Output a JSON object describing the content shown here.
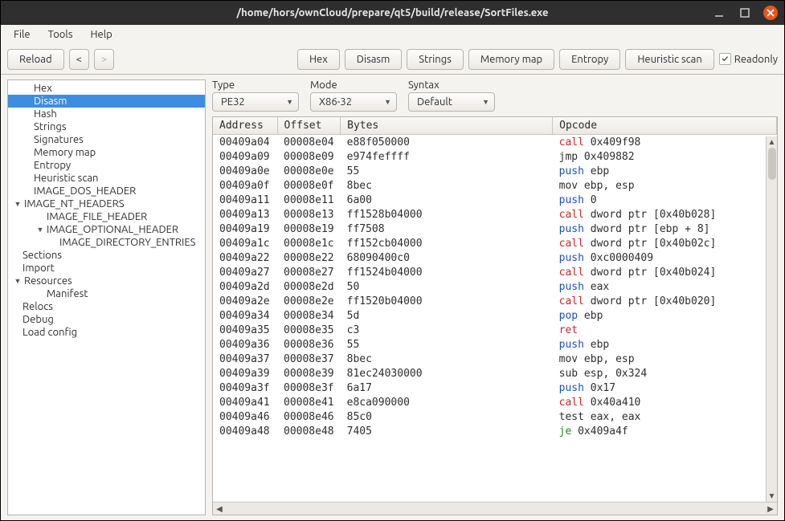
{
  "titlebar": {
    "title": "/home/hors/ownCloud/prepare/qt5/build/release/SortFiles.exe"
  },
  "menubar": {
    "items": [
      "File",
      "Tools",
      "Help"
    ]
  },
  "toolbar": {
    "reload": "Reload",
    "back": "<",
    "forward": ">",
    "views": [
      "Hex",
      "Disasm",
      "Strings",
      "Memory map",
      "Entropy",
      "Heuristic scan"
    ],
    "readonly_label": "Readonly",
    "readonly_checked": "✓"
  },
  "sidebar": {
    "items": [
      {
        "label": "Hex",
        "indent": "indent-1",
        "sel": false
      },
      {
        "label": "Disasm",
        "indent": "indent-1",
        "sel": true
      },
      {
        "label": "Hash",
        "indent": "indent-1",
        "sel": false
      },
      {
        "label": "Strings",
        "indent": "indent-1",
        "sel": false
      },
      {
        "label": "Signatures",
        "indent": "indent-1",
        "sel": false
      },
      {
        "label": "Memory map",
        "indent": "indent-1",
        "sel": false
      },
      {
        "label": "Entropy",
        "indent": "indent-1",
        "sel": false
      },
      {
        "label": "Heuristic scan",
        "indent": "indent-1",
        "sel": false
      },
      {
        "label": "IMAGE_DOS_HEADER",
        "indent": "indent-arrowed",
        "sel": false,
        "arrow": ""
      },
      {
        "label": "IMAGE_NT_HEADERS",
        "indent": "",
        "sel": false,
        "arrow": "▼"
      },
      {
        "label": "IMAGE_FILE_HEADER",
        "indent": "indent-2",
        "sel": false
      },
      {
        "label": "IMAGE_OPTIONAL_HEADER",
        "indent": "indent-arrowed-1",
        "sel": false,
        "arrow": "▼"
      },
      {
        "label": "IMAGE_DIRECTORY_ENTRIES",
        "indent": "indent-3",
        "sel": false
      },
      {
        "label": "Sections",
        "indent": "indent-arrowed",
        "sel": false
      },
      {
        "label": "Import",
        "indent": "indent-arrowed",
        "sel": false
      },
      {
        "label": "Resources",
        "indent": "",
        "sel": false,
        "arrow": "▼"
      },
      {
        "label": "Manifest",
        "indent": "indent-2",
        "sel": false
      },
      {
        "label": "Relocs",
        "indent": "indent-arrowed",
        "sel": false
      },
      {
        "label": "Debug",
        "indent": "indent-arrowed",
        "sel": false
      },
      {
        "label": "Load config",
        "indent": "indent-arrowed",
        "sel": false
      }
    ]
  },
  "filters": {
    "type_label": "Type",
    "type_value": "PE32",
    "mode_label": "Mode",
    "mode_value": "X86-32",
    "syntax_label": "Syntax",
    "syntax_value": "Default"
  },
  "table": {
    "headers": [
      "Address",
      "Offset",
      "Bytes",
      "Opcode"
    ],
    "rows": [
      {
        "addr": "00409a04",
        "off": "00008e04",
        "bytes": "e88f050000",
        "mn": "call",
        "class": "op-call",
        "args": "0x409f98"
      },
      {
        "addr": "00409a09",
        "off": "00008e09",
        "bytes": "e974feffff",
        "mn": "jmp",
        "class": "op-jmp",
        "args": "0x409882"
      },
      {
        "addr": "00409a0e",
        "off": "00008e0e",
        "bytes": "55",
        "mn": "push",
        "class": "op-push",
        "args": "ebp"
      },
      {
        "addr": "00409a0f",
        "off": "00008e0f",
        "bytes": "8bec",
        "mn": "mov",
        "class": "op-mov",
        "args": "ebp, esp"
      },
      {
        "addr": "00409a11",
        "off": "00008e11",
        "bytes": "6a00",
        "mn": "push",
        "class": "op-push",
        "args": "0"
      },
      {
        "addr": "00409a13",
        "off": "00008e13",
        "bytes": "ff1528b04000",
        "mn": "call",
        "class": "op-call",
        "args": "dword ptr [0x40b028]"
      },
      {
        "addr": "00409a19",
        "off": "00008e19",
        "bytes": "ff7508",
        "mn": "push",
        "class": "op-push",
        "args": "dword ptr [ebp + 8]"
      },
      {
        "addr": "00409a1c",
        "off": "00008e1c",
        "bytes": "ff152cb04000",
        "mn": "call",
        "class": "op-call",
        "args": "dword ptr [0x40b02c]"
      },
      {
        "addr": "00409a22",
        "off": "00008e22",
        "bytes": "68090400c0",
        "mn": "push",
        "class": "op-push",
        "args": "0xc0000409"
      },
      {
        "addr": "00409a27",
        "off": "00008e27",
        "bytes": "ff1524b04000",
        "mn": "call",
        "class": "op-call",
        "args": "dword ptr [0x40b024]"
      },
      {
        "addr": "00409a2d",
        "off": "00008e2d",
        "bytes": "50",
        "mn": "push",
        "class": "op-push",
        "args": "eax"
      },
      {
        "addr": "00409a2e",
        "off": "00008e2e",
        "bytes": "ff1520b04000",
        "mn": "call",
        "class": "op-call",
        "args": "dword ptr [0x40b020]"
      },
      {
        "addr": "00409a34",
        "off": "00008e34",
        "bytes": "5d",
        "mn": "pop",
        "class": "op-pop",
        "args": "ebp"
      },
      {
        "addr": "00409a35",
        "off": "00008e35",
        "bytes": "c3",
        "mn": "ret",
        "class": "op-ret",
        "args": ""
      },
      {
        "addr": "00409a36",
        "off": "00008e36",
        "bytes": "55",
        "mn": "push",
        "class": "op-push",
        "args": "ebp"
      },
      {
        "addr": "00409a37",
        "off": "00008e37",
        "bytes": "8bec",
        "mn": "mov",
        "class": "op-mov",
        "args": "ebp, esp"
      },
      {
        "addr": "00409a39",
        "off": "00008e39",
        "bytes": "81ec24030000",
        "mn": "sub",
        "class": "op-sub",
        "args": "esp, 0x324"
      },
      {
        "addr": "00409a3f",
        "off": "00008e3f",
        "bytes": "6a17",
        "mn": "push",
        "class": "op-push",
        "args": "0x17"
      },
      {
        "addr": "00409a41",
        "off": "00008e41",
        "bytes": "e8ca090000",
        "mn": "call",
        "class": "op-call",
        "args": "0x40a410"
      },
      {
        "addr": "00409a46",
        "off": "00008e46",
        "bytes": "85c0",
        "mn": "test",
        "class": "op-test",
        "args": "eax, eax"
      },
      {
        "addr": "00409a48",
        "off": "00008e48",
        "bytes": "7405",
        "mn": "je",
        "class": "op-je",
        "args": "0x409a4f"
      }
    ]
  }
}
